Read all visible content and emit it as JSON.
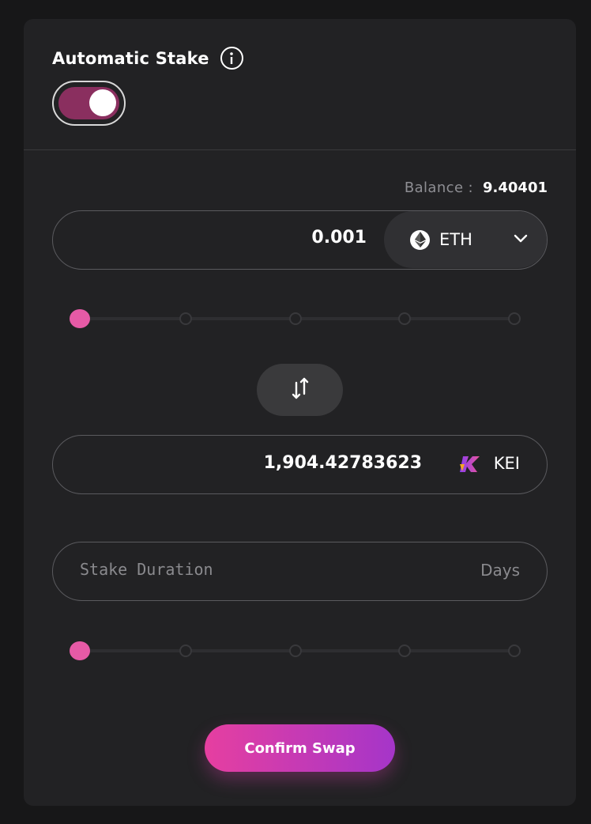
{
  "header": {
    "title": "Automatic Stake",
    "info_icon": "info-icon",
    "toggle_on": true
  },
  "balance": {
    "label": "Balance :",
    "value": "9.40401"
  },
  "from": {
    "amount": "0.001",
    "token": "ETH",
    "token_icon": "ethereum-icon"
  },
  "from_slider": {
    "value_fraction": 0,
    "stops": 5
  },
  "swap_icon": "swap-arrows-icon",
  "to": {
    "amount": "1,904.42783623",
    "token": "KEI",
    "token_icon": "kei-logo-icon"
  },
  "stake": {
    "placeholder": "Stake Duration",
    "unit": "Days"
  },
  "duration_slider": {
    "value_fraction": 0,
    "stops": 5
  },
  "confirm_label": "Confirm Swap",
  "colors": {
    "accent_pink": "#e65aa6",
    "toggle_on": "#8a2f5f",
    "button_gradient_start": "#e63fa0",
    "button_gradient_end": "#a535c9"
  }
}
